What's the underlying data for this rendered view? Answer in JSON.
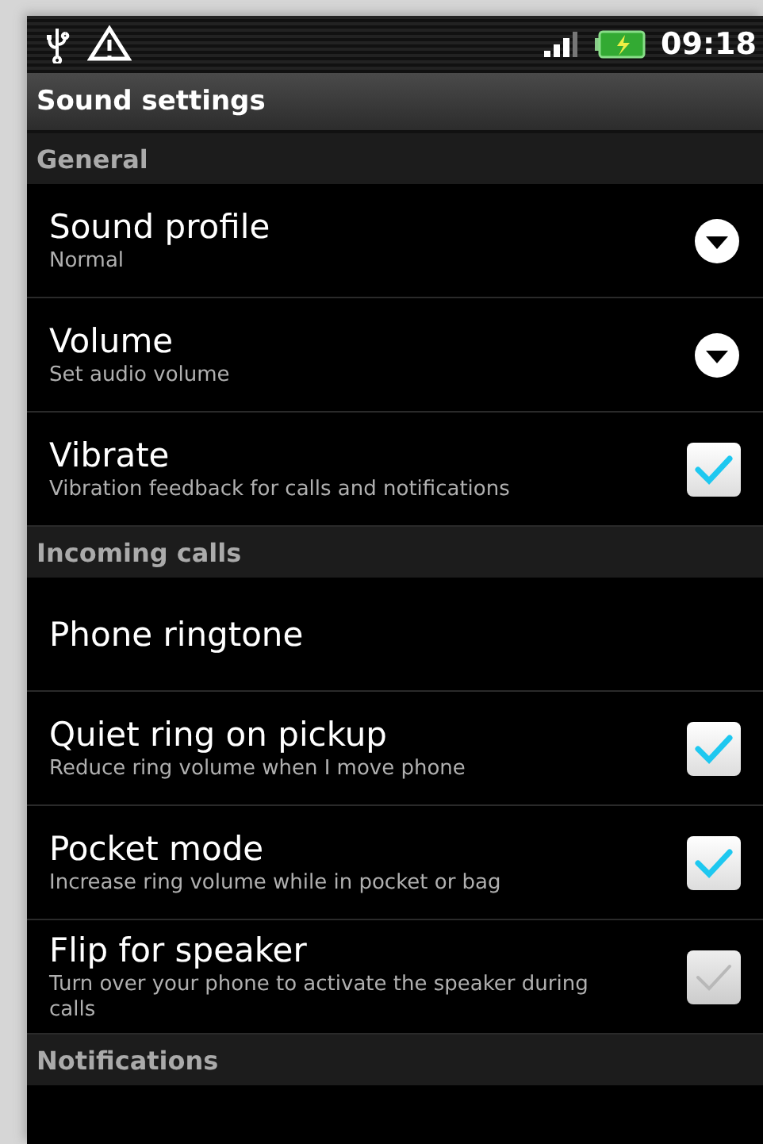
{
  "status_bar": {
    "time": "09:18"
  },
  "title": "Sound settings",
  "sections": [
    {
      "header": "General",
      "items": [
        {
          "kind": "dropdown",
          "title": "Sound profile",
          "summary": "Normal"
        },
        {
          "kind": "dropdown",
          "title": "Volume",
          "summary": "Set audio volume"
        },
        {
          "kind": "checkbox",
          "title": "Vibrate",
          "summary": "Vibration feedback for calls and notifications",
          "checked": true
        }
      ]
    },
    {
      "header": "Incoming calls",
      "items": [
        {
          "kind": "plain",
          "title": "Phone ringtone"
        },
        {
          "kind": "checkbox",
          "title": "Quiet ring on pickup",
          "summary": "Reduce ring volume when I move phone",
          "checked": true
        },
        {
          "kind": "checkbox",
          "title": "Pocket mode",
          "summary": "Increase ring volume while in pocket or bag",
          "checked": true
        },
        {
          "kind": "checkbox",
          "title": "Flip for speaker",
          "summary": "Turn over your phone to activate the speaker during calls",
          "checked": false
        }
      ]
    },
    {
      "header": "Notifications"
    }
  ]
}
